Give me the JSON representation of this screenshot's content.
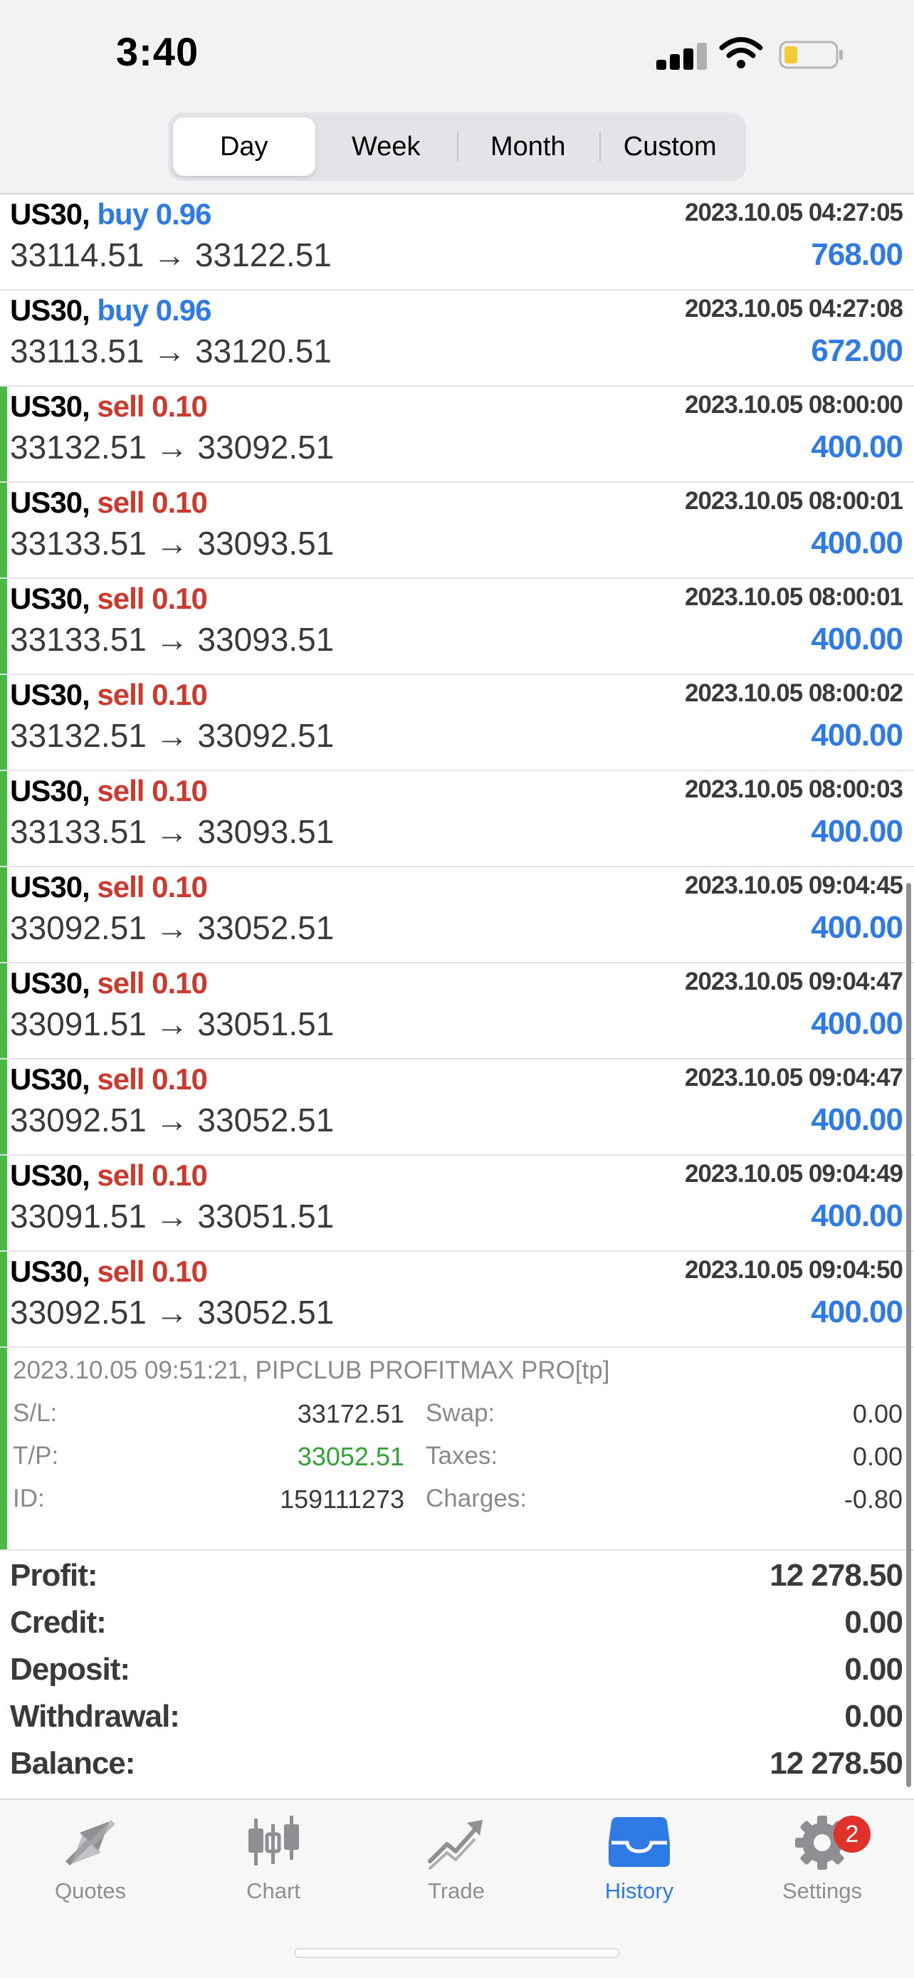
{
  "status_bar": {
    "time": "3:40"
  },
  "segments": [
    {
      "label": "Day",
      "active": true
    },
    {
      "label": "Week",
      "active": false
    },
    {
      "label": "Month",
      "active": false
    },
    {
      "label": "Custom",
      "active": false
    }
  ],
  "trades": [
    {
      "symbol": "US30,",
      "side": "buy 0.96",
      "type": "buy",
      "time": "2023.10.05 04:27:05",
      "prices": "33114.51 → 33122.51",
      "profit": "768.00",
      "marked": false
    },
    {
      "symbol": "US30,",
      "side": "buy 0.96",
      "type": "buy",
      "time": "2023.10.05 04:27:08",
      "prices": "33113.51 → 33120.51",
      "profit": "672.00",
      "marked": false
    },
    {
      "symbol": "US30,",
      "side": "sell 0.10",
      "type": "sell",
      "time": "2023.10.05 08:00:00",
      "prices": "33132.51 → 33092.51",
      "profit": "400.00",
      "marked": true
    },
    {
      "symbol": "US30,",
      "side": "sell 0.10",
      "type": "sell",
      "time": "2023.10.05 08:00:01",
      "prices": "33133.51 → 33093.51",
      "profit": "400.00",
      "marked": true
    },
    {
      "symbol": "US30,",
      "side": "sell 0.10",
      "type": "sell",
      "time": "2023.10.05 08:00:01",
      "prices": "33133.51 → 33093.51",
      "profit": "400.00",
      "marked": true
    },
    {
      "symbol": "US30,",
      "side": "sell 0.10",
      "type": "sell",
      "time": "2023.10.05 08:00:02",
      "prices": "33132.51 → 33092.51",
      "profit": "400.00",
      "marked": true
    },
    {
      "symbol": "US30,",
      "side": "sell 0.10",
      "type": "sell",
      "time": "2023.10.05 08:00:03",
      "prices": "33133.51 → 33093.51",
      "profit": "400.00",
      "marked": true
    },
    {
      "symbol": "US30,",
      "side": "sell 0.10",
      "type": "sell",
      "time": "2023.10.05 09:04:45",
      "prices": "33092.51 → 33052.51",
      "profit": "400.00",
      "marked": true
    },
    {
      "symbol": "US30,",
      "side": "sell 0.10",
      "type": "sell",
      "time": "2023.10.05 09:04:47",
      "prices": "33091.51 → 33051.51",
      "profit": "400.00",
      "marked": true
    },
    {
      "symbol": "US30,",
      "side": "sell 0.10",
      "type": "sell",
      "time": "2023.10.05 09:04:47",
      "prices": "33092.51 → 33052.51",
      "profit": "400.00",
      "marked": true
    },
    {
      "symbol": "US30,",
      "side": "sell 0.10",
      "type": "sell",
      "time": "2023.10.05 09:04:49",
      "prices": "33091.51 → 33051.51",
      "profit": "400.00",
      "marked": true
    },
    {
      "symbol": "US30,",
      "side": "sell 0.10",
      "type": "sell",
      "time": "2023.10.05 09:04:50",
      "prices": "33092.51 → 33052.51",
      "profit": "400.00",
      "marked": true
    }
  ],
  "details": {
    "comment": "2023.10.05 09:51:21, PIPCLUB PROFITMAX PRO[tp]",
    "sl_label": "S/L:",
    "sl_value": "33172.51",
    "tp_label": "T/P:",
    "tp_value": "33052.51",
    "id_label": "ID:",
    "id_value": "159111273",
    "swap_label": "Swap:",
    "swap_value": "0.00",
    "taxes_label": "Taxes:",
    "taxes_value": "0.00",
    "charges_label": "Charges:",
    "charges_value": "-0.80"
  },
  "summary": [
    {
      "label": "Profit:",
      "value": "12 278.50"
    },
    {
      "label": "Credit:",
      "value": "0.00"
    },
    {
      "label": "Deposit:",
      "value": "0.00"
    },
    {
      "label": "Withdrawal:",
      "value": "0.00"
    },
    {
      "label": "Balance:",
      "value": "12 278.50"
    }
  ],
  "tabbar": {
    "quotes": "Quotes",
    "chart": "Chart",
    "trade": "Trade",
    "history": "History",
    "settings": "Settings",
    "settings_badge": "2"
  },
  "colors": {
    "buy": "#2f7be5",
    "sell": "#cc3a2e",
    "profit": "#2f7be5",
    "marker": "#4cb848",
    "tp_value": "#34a233",
    "badge": "#e0312a"
  }
}
